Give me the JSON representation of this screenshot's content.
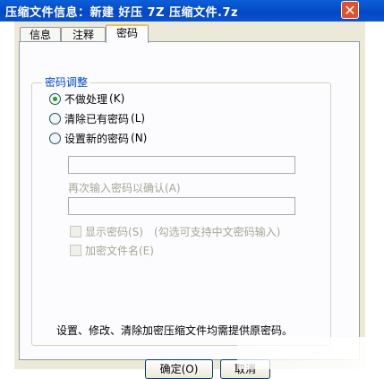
{
  "window": {
    "title": "压缩文件信息：新建 好压 7Z 压缩文件.7z",
    "close_label": "✕"
  },
  "tabs": [
    {
      "label": "信息",
      "active": false
    },
    {
      "label": "注释",
      "active": false
    },
    {
      "label": "密码",
      "active": true
    }
  ],
  "password_group": {
    "legend": "密码调整",
    "options": [
      {
        "label": "不做处理",
        "shortcut": "(K)",
        "checked": true
      },
      {
        "label": "清除已有密码",
        "shortcut": "(L)",
        "checked": false
      },
      {
        "label": "设置新的密码",
        "shortcut": "(N)",
        "checked": false
      }
    ],
    "new_password_value": "",
    "confirm_label": "再次输入密码以确认(A)",
    "confirm_value": "",
    "show_password": {
      "label": "显示密码(S)",
      "checked": false
    },
    "hint": "(勾选可支持中文密码输入)",
    "encrypt_names": {
      "label": "加密文件名(E)",
      "checked": false
    }
  },
  "footer_note": "设置、修改、清除加密压缩文件均需提供原密码。",
  "buttons": {
    "ok": "确定(O)",
    "cancel": "取消"
  },
  "colors": {
    "titlebar": "#0447c4",
    "legend": "#0046d5",
    "active_tab_accent": "#f7c24b",
    "radio_dot": "#21a121"
  }
}
